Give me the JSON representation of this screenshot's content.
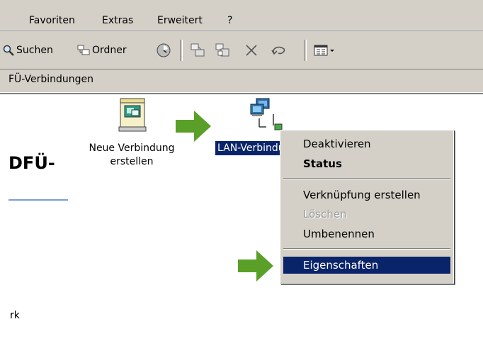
{
  "menubar": {
    "items": [
      "Favoriten",
      "Extras",
      "Erweitert",
      "?"
    ]
  },
  "toolbar": {
    "search_label": "Suchen",
    "folders_label": "Ordner"
  },
  "address": {
    "text": "FÜ-Verbindungen"
  },
  "left_panel": {
    "title": "DFÜ-",
    "footer_text": "rk"
  },
  "icons": {
    "new_connection_label": "Neue Verbindung erstellen",
    "lan_label": "LAN-Verbindung"
  },
  "context_menu": {
    "items": [
      {
        "label": "Deaktivieren"
      },
      {
        "label": "Status"
      },
      {
        "label": "Verknüpfung erstellen"
      },
      {
        "label": "Löschen"
      },
      {
        "label": "Umbenennen"
      },
      {
        "label": "Eigenschaften"
      }
    ]
  },
  "colors": {
    "chrome": "#d4d0c8",
    "selection": "#0a246a",
    "arrow_green": "#5aa028"
  }
}
